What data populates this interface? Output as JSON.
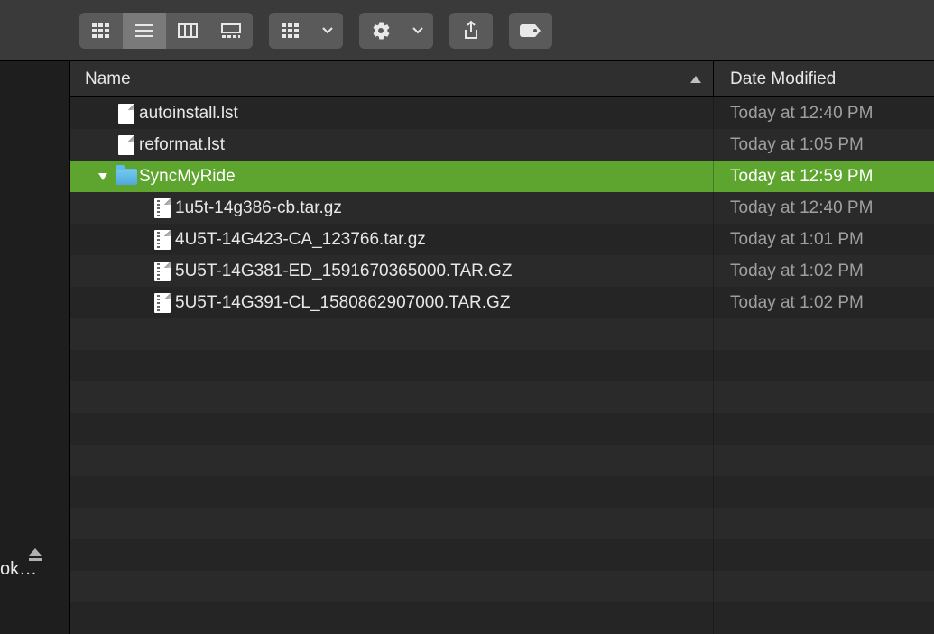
{
  "sidebar": {
    "truncated_label": "ok…"
  },
  "columns": {
    "name": "Name",
    "date": "Date Modified"
  },
  "rows": [
    {
      "name": "autoinstall.lst",
      "date": "Today at 12:40 PM",
      "type": "file",
      "indent": 0,
      "selected": false
    },
    {
      "name": "reformat.lst",
      "date": "Today at 1:05 PM",
      "type": "file",
      "indent": 0,
      "selected": false
    },
    {
      "name": "SyncMyRide",
      "date": "Today at 12:59 PM",
      "type": "folder",
      "indent": 0,
      "selected": true,
      "expanded": true
    },
    {
      "name": "1u5t-14g386-cb.tar.gz",
      "date": "Today at 12:40 PM",
      "type": "archive",
      "indent": 1,
      "selected": false
    },
    {
      "name": "4U5T-14G423-CA_123766.tar.gz",
      "date": "Today at 1:01 PM",
      "type": "archive",
      "indent": 1,
      "selected": false
    },
    {
      "name": "5U5T-14G381-ED_1591670365000.TAR.GZ",
      "date": "Today at 1:02 PM",
      "type": "archive",
      "indent": 1,
      "selected": false
    },
    {
      "name": "5U5T-14G391-CL_1580862907000.TAR.GZ",
      "date": "Today at 1:02 PM",
      "type": "archive",
      "indent": 1,
      "selected": false
    }
  ]
}
